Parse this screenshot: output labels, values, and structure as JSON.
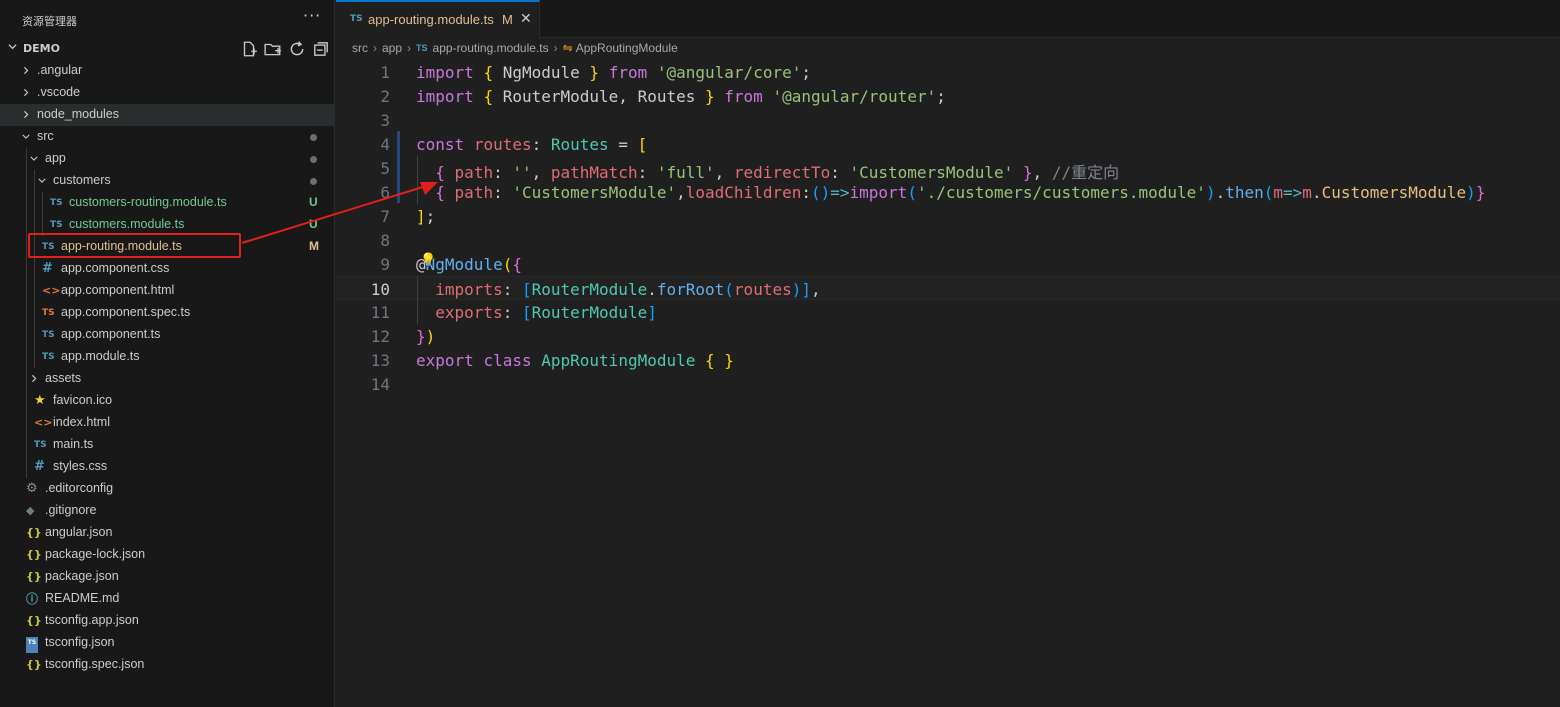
{
  "explorer": {
    "title": "资源管理器",
    "more_label": "···",
    "project": "DEMO",
    "items": [
      {
        "name": ".angular",
        "type": "folder",
        "depth": 1,
        "expanded": false,
        "icon": "folder-chevron"
      },
      {
        "name": ".vscode",
        "type": "folder",
        "depth": 1,
        "expanded": false,
        "icon": "folder-chevron"
      },
      {
        "name": "node_modules",
        "type": "folder",
        "depth": 1,
        "expanded": false,
        "icon": "folder-chevron",
        "hover": true
      },
      {
        "name": "src",
        "type": "folder",
        "depth": 1,
        "expanded": true,
        "icon": "folder-chevron",
        "dot": true
      },
      {
        "name": "app",
        "type": "folder",
        "depth": 2,
        "expanded": true,
        "icon": "folder-chevron",
        "dot": true
      },
      {
        "name": "customers",
        "type": "folder",
        "depth": 3,
        "expanded": true,
        "icon": "folder-chevron",
        "dot": true
      },
      {
        "name": "customers-routing.module.ts",
        "type": "file",
        "depth": 4,
        "icon": "ts",
        "badge": "U"
      },
      {
        "name": "customers.module.ts",
        "type": "file",
        "depth": 4,
        "icon": "ts",
        "badge": "U"
      },
      {
        "name": "app-routing.module.ts",
        "type": "file",
        "depth": 3,
        "icon": "ts",
        "badge": "M",
        "modified": true
      },
      {
        "name": "app.component.css",
        "type": "file",
        "depth": 3,
        "icon": "css"
      },
      {
        "name": "app.component.html",
        "type": "file",
        "depth": 3,
        "icon": "html"
      },
      {
        "name": "app.component.spec.ts",
        "type": "file",
        "depth": 3,
        "icon": "spec"
      },
      {
        "name": "app.component.ts",
        "type": "file",
        "depth": 3,
        "icon": "ts"
      },
      {
        "name": "app.module.ts",
        "type": "file",
        "depth": 3,
        "icon": "ts"
      },
      {
        "name": "assets",
        "type": "folder",
        "depth": 2,
        "expanded": false,
        "icon": "folder-chevron"
      },
      {
        "name": "favicon.ico",
        "type": "file",
        "depth": 2,
        "icon": "star"
      },
      {
        "name": "index.html",
        "type": "file",
        "depth": 2,
        "icon": "html"
      },
      {
        "name": "main.ts",
        "type": "file",
        "depth": 2,
        "icon": "ts"
      },
      {
        "name": "styles.css",
        "type": "file",
        "depth": 2,
        "icon": "css"
      },
      {
        "name": ".editorconfig",
        "type": "file",
        "depth": 1,
        "icon": "gear"
      },
      {
        "name": ".gitignore",
        "type": "file",
        "depth": 1,
        "icon": "git"
      },
      {
        "name": "angular.json",
        "type": "file",
        "depth": 1,
        "icon": "json"
      },
      {
        "name": "package-lock.json",
        "type": "file",
        "depth": 1,
        "icon": "json"
      },
      {
        "name": "package.json",
        "type": "file",
        "depth": 1,
        "icon": "json"
      },
      {
        "name": "README.md",
        "type": "file",
        "depth": 1,
        "icon": "info"
      },
      {
        "name": "tsconfig.app.json",
        "type": "file",
        "depth": 1,
        "icon": "json"
      },
      {
        "name": "tsconfig.json",
        "type": "file",
        "depth": 1,
        "icon": "tsconfig"
      },
      {
        "name": "tsconfig.spec.json",
        "type": "file",
        "depth": 1,
        "icon": "json"
      }
    ]
  },
  "tab": {
    "icon_text": "TS",
    "label": "app-routing.module.ts",
    "modified_badge": "M",
    "close_glyph": "✕"
  },
  "breadcrumb": {
    "segments": [
      "src",
      "app",
      "app-routing.module.ts",
      "AppRoutingModule"
    ],
    "ts_icon_text": "TS",
    "symbol_glyph": "⇋"
  },
  "editor": {
    "current_line": 10,
    "lines": [
      {
        "n": "1",
        "tokens": [
          [
            "kw",
            "import"
          ],
          [
            "p",
            " "
          ],
          [
            "br",
            "{"
          ],
          [
            "p",
            " NgModule "
          ],
          [
            "br",
            "}"
          ],
          [
            "p",
            " "
          ],
          [
            "kw",
            "from"
          ],
          [
            "p",
            " "
          ],
          [
            "str",
            "'@angular/core'"
          ],
          [
            "p",
            ";"
          ]
        ]
      },
      {
        "n": "2",
        "tokens": [
          [
            "kw",
            "import"
          ],
          [
            "p",
            " "
          ],
          [
            "br",
            "{"
          ],
          [
            "p",
            " RouterModule, Routes "
          ],
          [
            "br",
            "}"
          ],
          [
            "p",
            " "
          ],
          [
            "kw",
            "from"
          ],
          [
            "p",
            " "
          ],
          [
            "str",
            "'@angular/router'"
          ],
          [
            "p",
            ";"
          ]
        ]
      },
      {
        "n": "3",
        "tokens": []
      },
      {
        "n": "4",
        "tokens": [
          [
            "kw",
            "const"
          ],
          [
            "p",
            " "
          ],
          [
            "va",
            "routes"
          ],
          [
            "p",
            ": "
          ],
          [
            "ty",
            "Routes"
          ],
          [
            "p",
            " = "
          ],
          [
            "br",
            "["
          ]
        ]
      },
      {
        "n": "5",
        "tokens": [
          [
            "p",
            "  "
          ],
          [
            "br2",
            "{"
          ],
          [
            "p",
            " "
          ],
          [
            "va",
            "path"
          ],
          [
            "p",
            ": "
          ],
          [
            "str",
            "''"
          ],
          [
            "p",
            ", "
          ],
          [
            "va",
            "pathMatch"
          ],
          [
            "p",
            ": "
          ],
          [
            "str",
            "'full'"
          ],
          [
            "p",
            ", "
          ],
          [
            "va",
            "redirectTo"
          ],
          [
            "p",
            ": "
          ],
          [
            "str",
            "'CustomersModule'"
          ],
          [
            "p",
            " "
          ],
          [
            "br2",
            "}"
          ],
          [
            "p",
            ", "
          ],
          [
            "cm",
            "//重定向"
          ]
        ]
      },
      {
        "n": "6",
        "tokens": [
          [
            "p",
            "  "
          ],
          [
            "br2",
            "{"
          ],
          [
            "p",
            " "
          ],
          [
            "va",
            "path"
          ],
          [
            "p",
            ": "
          ],
          [
            "str",
            "'CustomersModule'"
          ],
          [
            "p",
            ","
          ],
          [
            "va",
            "loadChildren"
          ],
          [
            "p",
            ":"
          ],
          [
            "br3",
            "()"
          ],
          [
            "op",
            "=>"
          ],
          [
            "kw",
            "import"
          ],
          [
            "br3",
            "("
          ],
          [
            "str",
            "'./customers/customers.module'"
          ],
          [
            "br3",
            ")"
          ],
          [
            "p",
            "."
          ],
          [
            "fn",
            "then"
          ],
          [
            "br3",
            "("
          ],
          [
            "va",
            "m"
          ],
          [
            "op",
            "=>"
          ],
          [
            "va",
            "m"
          ],
          [
            "p",
            "."
          ],
          [
            "prop",
            "CustomersModule"
          ],
          [
            "br3",
            ")"
          ],
          [
            "br2",
            "}"
          ]
        ]
      },
      {
        "n": "7",
        "tokens": [
          [
            "br",
            "]"
          ],
          [
            "p",
            ";"
          ]
        ]
      },
      {
        "n": "8",
        "tokens": []
      },
      {
        "n": "9",
        "tokens": [
          [
            "p",
            "@"
          ],
          [
            "fn",
            "NgModule"
          ],
          [
            "br",
            "("
          ],
          [
            "br2",
            "{"
          ]
        ]
      },
      {
        "n": "10",
        "tokens": [
          [
            "p",
            "  "
          ],
          [
            "va",
            "imports"
          ],
          [
            "p",
            ": "
          ],
          [
            "br3",
            "["
          ],
          [
            "ty",
            "RouterModule"
          ],
          [
            "p",
            "."
          ],
          [
            "fn",
            "forRoot"
          ],
          [
            "br3",
            "("
          ],
          [
            "va",
            "routes"
          ],
          [
            "br3",
            ")"
          ],
          [
            "br3",
            "]"
          ],
          [
            "p",
            ","
          ]
        ]
      },
      {
        "n": "11",
        "tokens": [
          [
            "p",
            "  "
          ],
          [
            "va",
            "exports"
          ],
          [
            "p",
            ": "
          ],
          [
            "br3",
            "["
          ],
          [
            "ty",
            "RouterModule"
          ],
          [
            "br3",
            "]"
          ]
        ]
      },
      {
        "n": "12",
        "tokens": [
          [
            "br2",
            "}"
          ],
          [
            "br",
            ")"
          ]
        ]
      },
      {
        "n": "13",
        "tokens": [
          [
            "kw",
            "export"
          ],
          [
            "p",
            " "
          ],
          [
            "kw",
            "class"
          ],
          [
            "p",
            " "
          ],
          [
            "ty",
            "AppRoutingModule"
          ],
          [
            "p",
            " "
          ],
          [
            "br",
            "{"
          ],
          [
            "p",
            " "
          ],
          [
            "br",
            "}"
          ]
        ]
      },
      {
        "n": "14",
        "tokens": []
      }
    ]
  },
  "annotation": {
    "color": "#e0201b"
  }
}
